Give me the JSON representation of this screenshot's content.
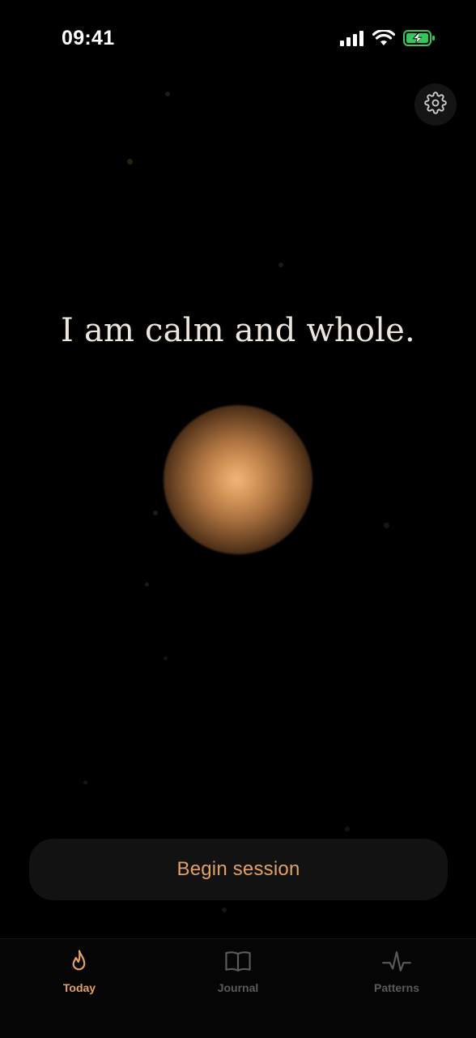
{
  "status_bar": {
    "time": "09:41",
    "icons": [
      "signal-icon",
      "wifi-icon",
      "battery-charging-icon"
    ]
  },
  "header": {
    "settings_icon": "gear-icon"
  },
  "main": {
    "affirmation": "I am calm and whole.",
    "orb": "glowing-orb"
  },
  "actions": {
    "begin_label": "Begin session"
  },
  "tab_bar": {
    "tabs": [
      {
        "label": "Today",
        "icon": "flame-icon",
        "active": true
      },
      {
        "label": "Journal",
        "icon": "book-icon",
        "active": false
      },
      {
        "label": "Patterns",
        "icon": "pulse-icon",
        "active": false
      }
    ]
  },
  "colors": {
    "background": "#000000",
    "accent": "#e3a063",
    "text": "#ece6dc",
    "inactive": "#5a5a5a",
    "battery_green": "#34c759"
  }
}
